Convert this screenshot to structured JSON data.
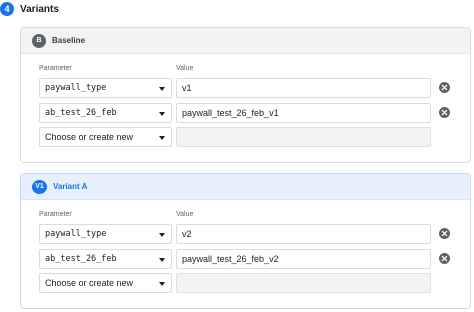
{
  "section": {
    "step_number": "4",
    "title": "Variants"
  },
  "column_labels": {
    "parameter": "Parameter",
    "value": "Value"
  },
  "placeholder_select": "Choose or create new",
  "colors": {
    "accent": "#1a73e8",
    "baseline_badge": "#5f6368",
    "variant_header_bg": "#e8f0fe"
  },
  "variants": [
    {
      "badge": "B",
      "name": "Baseline",
      "rows": [
        {
          "parameter": "paywall_type",
          "value": "v1"
        },
        {
          "parameter": "ab_test_26_feb",
          "value": "paywall_test_26_feb_v1"
        }
      ]
    },
    {
      "badge": "V1",
      "name": "Variant A",
      "rows": [
        {
          "parameter": "paywall_type",
          "value": "v2"
        },
        {
          "parameter": "ab_test_26_feb",
          "value": "paywall_test_26_feb_v2"
        }
      ]
    }
  ]
}
